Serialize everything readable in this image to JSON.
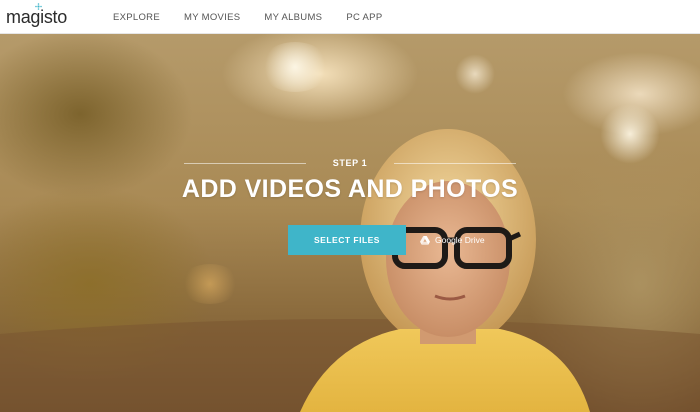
{
  "brand": {
    "logo_text": "magisto",
    "accent": "#3fb5c9"
  },
  "nav": {
    "items": [
      {
        "label": "EXPLORE"
      },
      {
        "label": "MY MOVIES"
      },
      {
        "label": "MY ALBUMS"
      },
      {
        "label": "PC APP"
      }
    ]
  },
  "hero": {
    "step_label": "STEP 1",
    "headline": "ADD VIDEOS AND PHOTOS",
    "select_button_label": "SELECT FILES",
    "select_button_color": "#3fb5c9",
    "gdrive_label": "Google Drive",
    "gdrive_icon": "google-drive-icon"
  }
}
